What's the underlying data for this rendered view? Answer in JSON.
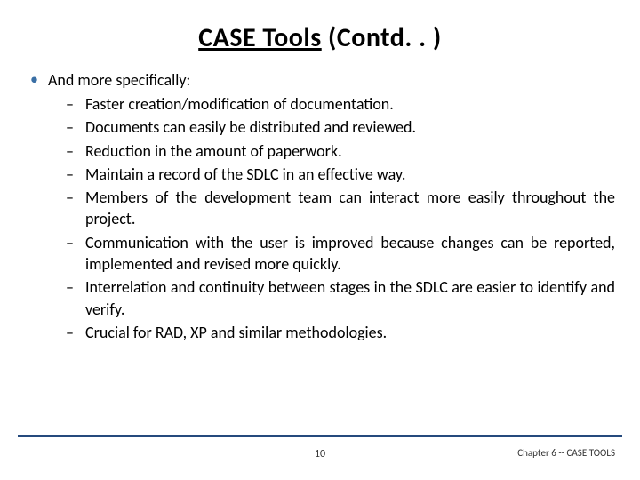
{
  "title": {
    "main": "CASE Tools",
    "suffix": " (Contd. . )"
  },
  "lead": "And more specifically:",
  "bullets": [
    "Faster creation/modification of documentation.",
    "Documents can easily be distributed and reviewed.",
    "Reduction in the amount of paperwork.",
    "Maintain a record of the SDLC in an effective way.",
    "Members of the development team can interact more easily throughout the project.",
    "Communication with the user is improved because changes can be reported, implemented and revised more quickly.",
    "Interrelation and continuity between stages in the SDLC are easier to identify and verify.",
    "Crucial for RAD, XP and similar methodologies."
  ],
  "page_number": "10",
  "chapter": "Chapter 6 -- CASE TOOLS"
}
